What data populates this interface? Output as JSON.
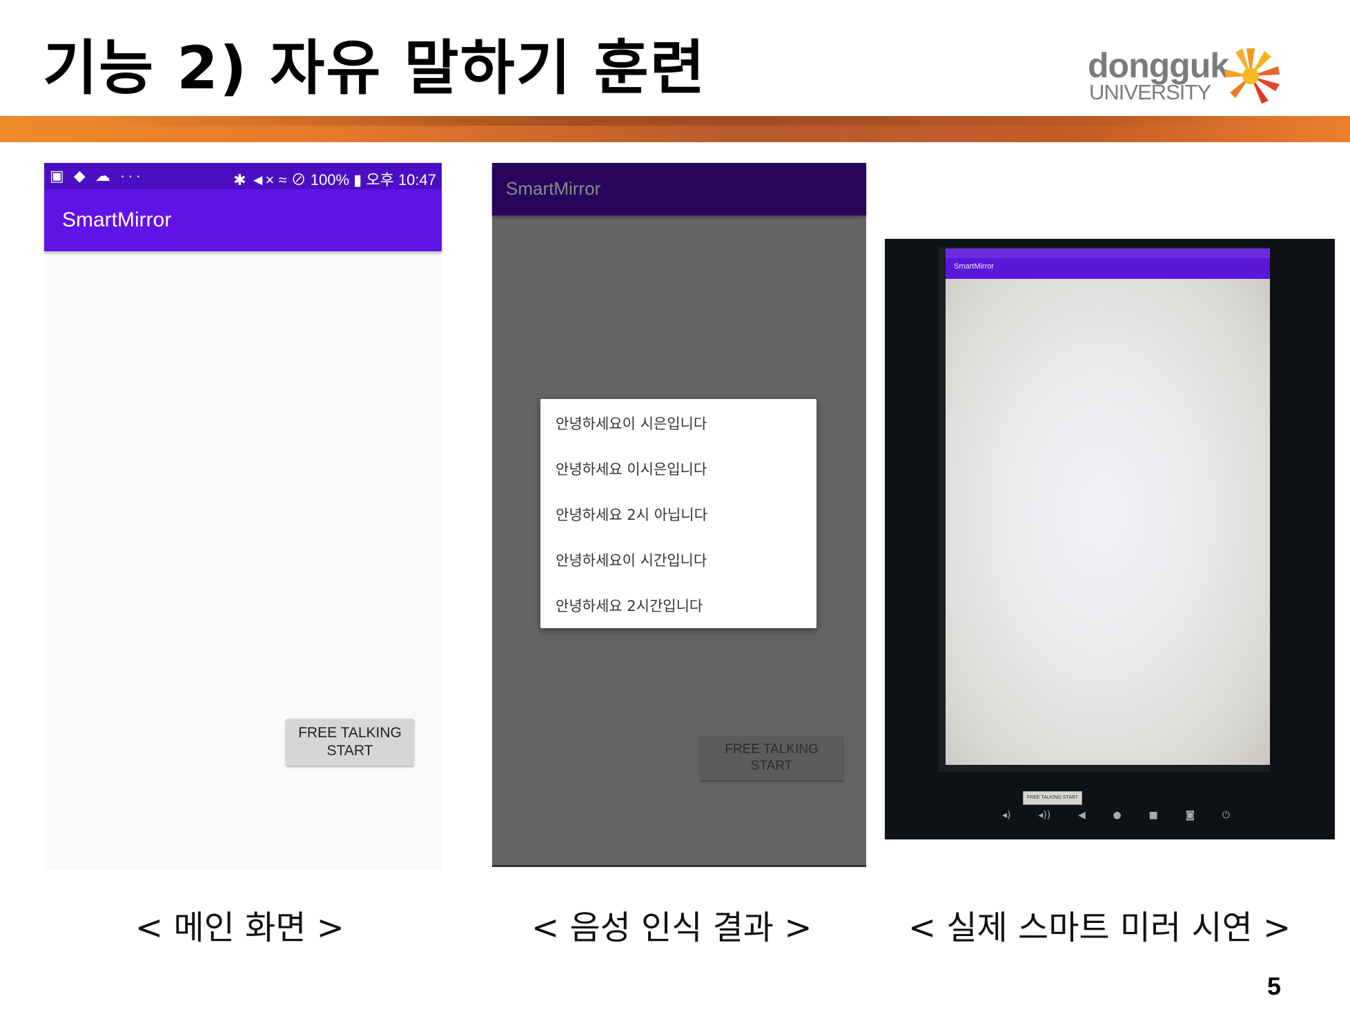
{
  "slide": {
    "title": "기능 2) 자유 말하기 훈련",
    "page_number": "5"
  },
  "logo": {
    "line1": "dongguk",
    "line2": "UNIVERSITY"
  },
  "phone_main": {
    "status_left": "▣ ◆ ☁ ···",
    "status_right": "✱ ◄× ≈ ⊘ 100% ▮ 오후 10:47",
    "app_title": "SmartMirror",
    "button_label": "FREE TALKING START",
    "button_line1": "FREE TALKING",
    "button_line2": "START"
  },
  "phone_result": {
    "app_title": "SmartMirror",
    "options": [
      "안녕하세요이 시은입니다",
      "안녕하세요 이시은입니다",
      "안녕하세요 2시 아닙니다",
      "안녕하세요이 시간입니다",
      "안녕하세요 2시간입니다"
    ],
    "button_line1": "FREE TALKING",
    "button_line2": "START"
  },
  "mirror_photo": {
    "app_title": "SmartMirror",
    "button_label": "FREE TALKING START",
    "nav_icons": [
      "volume-down-icon",
      "volume-up-icon",
      "back-icon",
      "home-icon",
      "recent-icon",
      "camera-icon",
      "power-icon"
    ]
  },
  "captions": {
    "main": "< 메인 화면 >",
    "result": "< 음성 인식 결과 >",
    "demo": "< 실제 스마트 미러 시연 >"
  },
  "colors": {
    "status_bar": "#4a0fc2",
    "app_bar": "#6112e6",
    "accent_band": "#e4792b"
  }
}
